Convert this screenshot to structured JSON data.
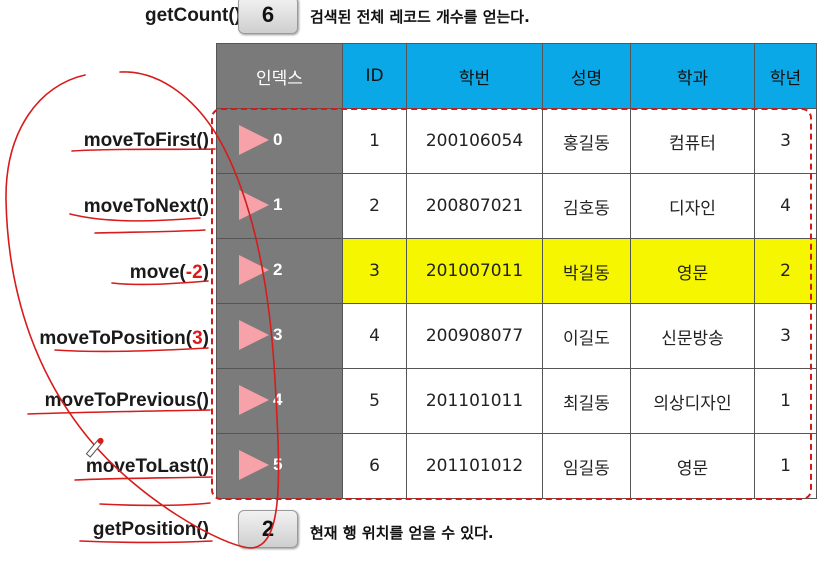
{
  "top": {
    "method": "getCount()",
    "value": "6",
    "description": "검색된 전체 레코드 개수를 얻는다."
  },
  "bottom": {
    "method": "getPosition()",
    "value": "2",
    "description": "현재 행 위치를 얻을 수 있다."
  },
  "methods": [
    {
      "name": "moveToFirst()",
      "pre": "moveToFirst()",
      "arg": "",
      "post": ""
    },
    {
      "name": "moveToNext()",
      "pre": "moveToNext()",
      "arg": "",
      "post": ""
    },
    {
      "name": "move(-2)",
      "pre": "move(",
      "arg": "-2",
      "post": ")"
    },
    {
      "name": "moveToPosition(3)",
      "pre": "moveToPosition(",
      "arg": "3",
      "post": ")"
    },
    {
      "name": "moveToPrevious()",
      "pre": "moveToPrevious()",
      "arg": "",
      "post": ""
    },
    {
      "name": "moveToLast()",
      "pre": "moveToLast()",
      "arg": "",
      "post": ""
    }
  ],
  "table": {
    "headers": [
      "인덱스",
      "ID",
      "학번",
      "성명",
      "학과",
      "학년"
    ],
    "rows": [
      {
        "index": "0",
        "cells": [
          "1",
          "200106054",
          "홍길동",
          "컴퓨터",
          "3"
        ]
      },
      {
        "index": "1",
        "cells": [
          "2",
          "200807021",
          "김호동",
          "디자인",
          "4"
        ]
      },
      {
        "index": "2",
        "cells": [
          "3",
          "201007011",
          "박길동",
          "영문",
          "2"
        ]
      },
      {
        "index": "3",
        "cells": [
          "4",
          "200908077",
          "이길도",
          "신문방송",
          "3"
        ]
      },
      {
        "index": "4",
        "cells": [
          "5",
          "201101011",
          "최길동",
          "의상디자인",
          "1"
        ]
      },
      {
        "index": "5",
        "cells": [
          "6",
          "201101012",
          "임길동",
          "영문",
          "1"
        ]
      }
    ],
    "highlighted_row_index": "2"
  },
  "colors": {
    "header_blue": "#0aa8e6",
    "index_gray": "#7b7b7b",
    "highlight": "#f6f600",
    "ink_red": "#d81b1b",
    "pointer_pink": "#f7a1a8"
  }
}
